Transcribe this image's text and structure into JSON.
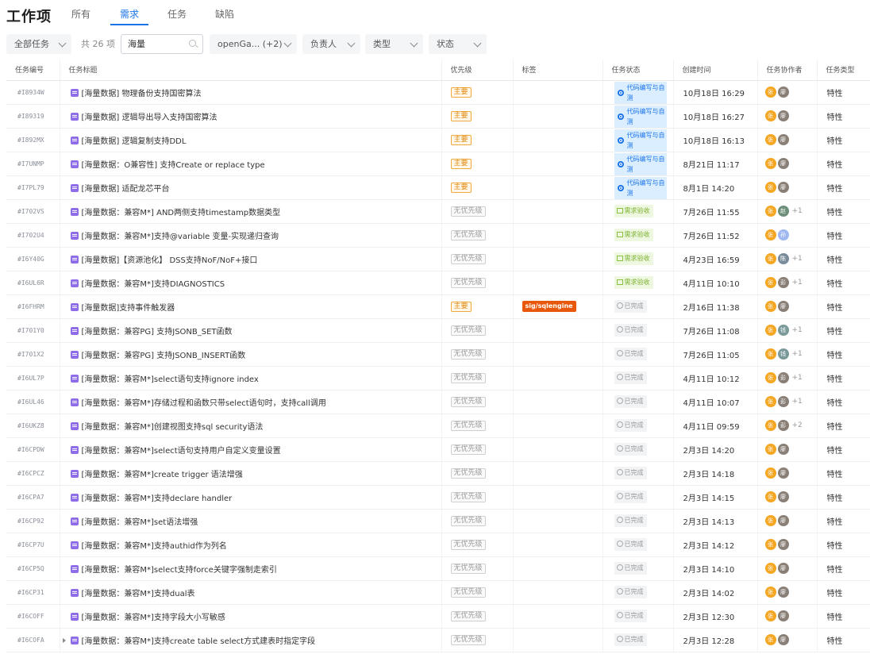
{
  "header": {
    "title": "工作项",
    "tabs": [
      {
        "label": "所有",
        "active": false
      },
      {
        "label": "需求",
        "active": true
      },
      {
        "label": "任务",
        "active": false
      },
      {
        "label": "缺陷",
        "active": false
      }
    ]
  },
  "filters": {
    "scope": "全部任务",
    "count": "共 26 项",
    "search_value": "海量",
    "project": "openGa...  (+2)",
    "assignee": "负责人",
    "type": "类型",
    "status": "状态"
  },
  "columns": [
    "任务编号",
    "任务标题",
    "优先级",
    "标签",
    "任务状态",
    "创建时间",
    "任务协作者",
    "任务类型"
  ],
  "colors": {
    "accent": "#1a73e8",
    "major": "#f0a93a",
    "tag": "#e8580c",
    "avatar_zhang": "#f5a623"
  },
  "rows": [
    {
      "id": "#I8934W",
      "title": "[海量数据] 物理备份支持国密算法",
      "priority": "主要",
      "tag": "",
      "status": "代码编写与自测",
      "status_kind": "code",
      "created": "10月18日 16:29",
      "collab": [
        {
          "t": "张",
          "c": "#f5a623"
        },
        {
          "t": "廖",
          "c": "#8a7f77"
        }
      ],
      "plus": "",
      "type": "特性"
    },
    {
      "id": "#I89319",
      "title": "[海量数据] 逻辑导出导入支持国密算法",
      "priority": "主要",
      "tag": "",
      "status": "代码编写与自测",
      "status_kind": "code",
      "created": "10月18日 16:27",
      "collab": [
        {
          "t": "张",
          "c": "#f5a623"
        },
        {
          "t": "廖",
          "c": "#8a7f77"
        }
      ],
      "plus": "",
      "type": "特性"
    },
    {
      "id": "#I892MX",
      "title": "[海量数据] 逻辑复制支持DDL",
      "priority": "主要",
      "tag": "",
      "status": "代码编写与自测",
      "status_kind": "code",
      "created": "10月18日 16:13",
      "collab": [
        {
          "t": "张",
          "c": "#f5a623"
        },
        {
          "t": "廖",
          "c": "#8a7f77"
        }
      ],
      "plus": "",
      "type": "特性"
    },
    {
      "id": "#I7UNMP",
      "title": "[海量数据：O兼容性] 支持Create or replace type",
      "priority": "主要",
      "tag": "",
      "status": "代码编写与自测",
      "status_kind": "code",
      "created": "8月21日 11:17",
      "collab": [
        {
          "t": "张",
          "c": "#f5a623"
        },
        {
          "t": "廖",
          "c": "#8a7f77"
        }
      ],
      "plus": "",
      "type": "特性"
    },
    {
      "id": "#I7PL79",
      "title": "[海量数据] 适配龙芯平台",
      "priority": "主要",
      "tag": "",
      "status": "代码编写与自测",
      "status_kind": "code",
      "created": "8月1日 14:20",
      "collab": [
        {
          "t": "张",
          "c": "#f5a623"
        },
        {
          "t": "廖",
          "c": "#8a7f77"
        }
      ],
      "plus": "",
      "type": "特性"
    },
    {
      "id": "#I702VS",
      "title": "[海量数据：兼容M*] AND两侧支持timestamp数据类型",
      "priority": "无优先级",
      "tag": "",
      "status": "需求验收",
      "status_kind": "accept",
      "created": "7月26日 11:55",
      "collab": [
        {
          "t": "张",
          "c": "#f5a623"
        },
        {
          "t": "赵",
          "c": "#6d8f7a"
        }
      ],
      "plus": "+1",
      "type": "特性"
    },
    {
      "id": "#I702U4",
      "title": "[海量数据：兼容M*]支持@variable 变量-实现递归查询",
      "priority": "无优先级",
      "tag": "",
      "status": "需求验收",
      "status_kind": "accept",
      "created": "7月26日 11:52",
      "collab": [
        {
          "t": "张",
          "c": "#f5a623"
        },
        {
          "t": "孙",
          "c": "#9fb8f0"
        }
      ],
      "plus": "",
      "type": "特性"
    },
    {
      "id": "#I6Y40G",
      "title": "[海量数据]【资源池化】 DSS支持NoF/NoF+接口",
      "priority": "无优先级",
      "tag": "",
      "status": "需求验收",
      "status_kind": "accept",
      "created": "4月23日 16:59",
      "collab": [
        {
          "t": "张",
          "c": "#f5a623"
        },
        {
          "t": "陈",
          "c": "#7a8b9a"
        }
      ],
      "plus": "+1",
      "type": "特性"
    },
    {
      "id": "#I6UL6R",
      "title": "[海量数据：兼容M*]支持DIAGNOSTICS",
      "priority": "无优先级",
      "tag": "",
      "status": "需求验收",
      "status_kind": "accept",
      "created": "4月11日 10:10",
      "collab": [
        {
          "t": "张",
          "c": "#f5a623"
        },
        {
          "t": "彭",
          "c": "#8a7f77"
        }
      ],
      "plus": "+1",
      "type": "特性"
    },
    {
      "id": "#I6FHRM",
      "title": "[海量数据]支持事件触发器",
      "priority": "主要",
      "tag": "sig/sqlengine",
      "status": "已完成",
      "status_kind": "done",
      "created": "2月16日 11:38",
      "collab": [
        {
          "t": "张",
          "c": "#f5a623"
        },
        {
          "t": "廖",
          "c": "#8a7f77"
        }
      ],
      "plus": "",
      "type": "特性"
    },
    {
      "id": "#I701Y0",
      "title": "[海量数据：兼容PG] 支持JSONB_SET函数",
      "priority": "无优先级",
      "tag": "",
      "status": "已完成",
      "status_kind": "done",
      "created": "7月26日 11:08",
      "collab": [
        {
          "t": "张",
          "c": "#f5a623"
        },
        {
          "t": "钱",
          "c": "#7a9a9a"
        }
      ],
      "plus": "+1",
      "type": "特性"
    },
    {
      "id": "#I701X2",
      "title": "[海量数据：兼容PG] 支持JSONB_INSERT函数",
      "priority": "无优先级",
      "tag": "",
      "status": "已完成",
      "status_kind": "done",
      "created": "7月26日 11:05",
      "collab": [
        {
          "t": "张",
          "c": "#f5a623"
        },
        {
          "t": "钱",
          "c": "#7a9a9a"
        }
      ],
      "plus": "+1",
      "type": "特性"
    },
    {
      "id": "#I6UL7P",
      "title": "[海量数据：兼容M*]select语句支持ignore index",
      "priority": "无优先级",
      "tag": "",
      "status": "已完成",
      "status_kind": "done",
      "created": "4月11日 10:12",
      "collab": [
        {
          "t": "张",
          "c": "#f5a623"
        },
        {
          "t": "彭",
          "c": "#8a7f77"
        }
      ],
      "plus": "+1",
      "type": "特性"
    },
    {
      "id": "#I6UL46",
      "title": "[海量数据：兼容M*]存储过程和函数只带select语句时，支持call调用",
      "priority": "无优先级",
      "tag": "",
      "status": "已完成",
      "status_kind": "done",
      "created": "4月11日 10:07",
      "collab": [
        {
          "t": "张",
          "c": "#f5a623"
        },
        {
          "t": "彭",
          "c": "#8a7f77"
        }
      ],
      "plus": "+1",
      "type": "特性"
    },
    {
      "id": "#I6UKZ8",
      "title": "[海量数据：兼容M*]创建视图支持sql security语法",
      "priority": "无优先级",
      "tag": "",
      "status": "已完成",
      "status_kind": "done",
      "created": "4月11日 09:59",
      "collab": [
        {
          "t": "张",
          "c": "#f5a623"
        },
        {
          "t": "彭",
          "c": "#8a7f77"
        }
      ],
      "plus": "+2",
      "type": "特性"
    },
    {
      "id": "#I6CPDW",
      "title": "[海量数据：兼容M*]select语句支持用户自定义变量设置",
      "priority": "无优先级",
      "tag": "",
      "status": "已完成",
      "status_kind": "done",
      "created": "2月3日 14:20",
      "collab": [
        {
          "t": "张",
          "c": "#f5a623"
        },
        {
          "t": "廖",
          "c": "#8a7f77"
        }
      ],
      "plus": "",
      "type": "特性"
    },
    {
      "id": "#I6CPCZ",
      "title": "[海量数据：兼容M*]create trigger 语法增强",
      "priority": "无优先级",
      "tag": "",
      "status": "已完成",
      "status_kind": "done",
      "created": "2月3日 14:18",
      "collab": [
        {
          "t": "张",
          "c": "#f5a623"
        },
        {
          "t": "廖",
          "c": "#8a7f77"
        }
      ],
      "plus": "",
      "type": "特性"
    },
    {
      "id": "#I6CPA7",
      "title": "[海量数据：兼容M*]支持declare handler",
      "priority": "无优先级",
      "tag": "",
      "status": "已完成",
      "status_kind": "done",
      "created": "2月3日 14:15",
      "collab": [
        {
          "t": "张",
          "c": "#f5a623"
        },
        {
          "t": "廖",
          "c": "#8a7f77"
        }
      ],
      "plus": "",
      "type": "特性"
    },
    {
      "id": "#I6CP92",
      "title": "[海量数据：兼容M*]set语法增强",
      "priority": "无优先级",
      "tag": "",
      "status": "已完成",
      "status_kind": "done",
      "created": "2月3日 14:13",
      "collab": [
        {
          "t": "张",
          "c": "#f5a623"
        },
        {
          "t": "廖",
          "c": "#8a7f77"
        }
      ],
      "plus": "",
      "type": "特性"
    },
    {
      "id": "#I6CP7U",
      "title": "[海量数据：兼容M*]支持authid作为列名",
      "priority": "无优先级",
      "tag": "",
      "status": "已完成",
      "status_kind": "done",
      "created": "2月3日 14:12",
      "collab": [
        {
          "t": "张",
          "c": "#f5a623"
        },
        {
          "t": "廖",
          "c": "#8a7f77"
        }
      ],
      "plus": "",
      "type": "特性"
    },
    {
      "id": "#I6CP5Q",
      "title": "[海量数据：兼容M*]select支持force关键字强制走索引",
      "priority": "无优先级",
      "tag": "",
      "status": "已完成",
      "status_kind": "done",
      "created": "2月3日 14:10",
      "collab": [
        {
          "t": "张",
          "c": "#f5a623"
        },
        {
          "t": "廖",
          "c": "#8a7f77"
        }
      ],
      "plus": "",
      "type": "特性"
    },
    {
      "id": "#I6CP31",
      "title": "[海量数据：兼容M*]支持dual表",
      "priority": "无优先级",
      "tag": "",
      "status": "已完成",
      "status_kind": "done",
      "created": "2月3日 14:02",
      "collab": [
        {
          "t": "张",
          "c": "#f5a623"
        },
        {
          "t": "廖",
          "c": "#8a7f77"
        }
      ],
      "plus": "",
      "type": "特性"
    },
    {
      "id": "#I6COFF",
      "title": "[海量数据：兼容M*]支持字段大小写敏感",
      "priority": "无优先级",
      "tag": "",
      "status": "已完成",
      "status_kind": "done",
      "created": "2月3日 12:30",
      "collab": [
        {
          "t": "张",
          "c": "#f5a623"
        },
        {
          "t": "廖",
          "c": "#8a7f77"
        }
      ],
      "plus": "",
      "type": "特性"
    },
    {
      "id": "#I6COFA",
      "title": "[海量数据：兼容M*]支持create table select方式建表时指定字段",
      "priority": "无优先级",
      "tag": "",
      "status": "已完成",
      "status_kind": "done",
      "created": "2月3日 12:28",
      "collab": [
        {
          "t": "张",
          "c": "#f5a623"
        },
        {
          "t": "廖",
          "c": "#8a7f77"
        }
      ],
      "plus": "",
      "type": "特性",
      "expandable": true
    }
  ]
}
